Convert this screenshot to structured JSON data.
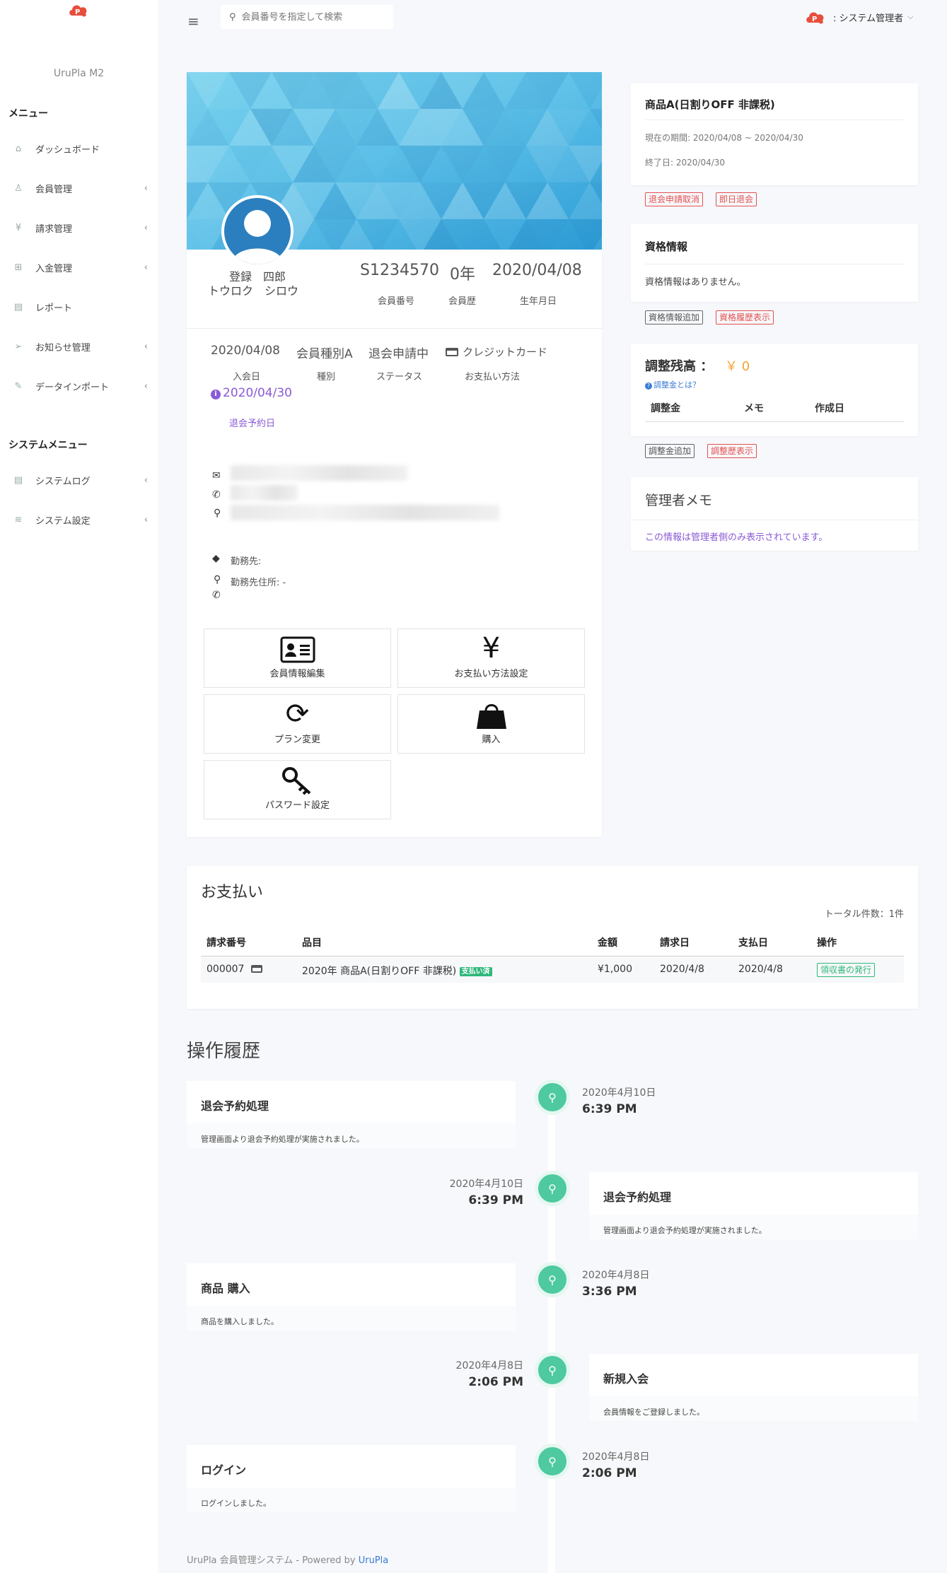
{
  "brand": "UruPla M2",
  "sidebar": {
    "menu_heading": "メニュー",
    "items": [
      {
        "label": "ダッシュボード",
        "icon": "home-icon"
      },
      {
        "label": "会員管理",
        "icon": "user-icon"
      },
      {
        "label": "請求管理",
        "icon": "yen-icon"
      },
      {
        "label": "入金管理",
        "icon": "bank-icon"
      },
      {
        "label": "レポート",
        "icon": "file-icon"
      },
      {
        "label": "お知らせ管理",
        "icon": "paper-plane-icon"
      },
      {
        "label": "データインポート",
        "icon": "edit-icon"
      }
    ],
    "system_heading": "システムメニュー",
    "system_items": [
      {
        "label": "システムログ",
        "icon": "file-icon"
      },
      {
        "label": "システム設定",
        "icon": "layers-icon"
      }
    ],
    "chevron": "‹"
  },
  "header": {
    "search_placeholder": "会員番号を指定して検索",
    "user_name": ": システム管理者"
  },
  "profile": {
    "name": "登録　四郎",
    "kana": "トウロク　シロウ",
    "member_no": "S1234570",
    "member_no_label": "会員番号",
    "years": "0年",
    "years_label": "会員歴",
    "birthday": "2020/04/08",
    "birthday_label": "生年月日",
    "join_date": "2020/04/08",
    "join_label": "入会日",
    "type": "会員種別A",
    "type_label": "種別",
    "status": "退会申請中",
    "status_label": "ステータス",
    "payment": "クレジットカード",
    "payment_label": "お支払い方法",
    "reserve_date": "2020/04/30",
    "reserve_label": "退会予約日",
    "workplace": "勤務先:",
    "workplace_address": "勤務先住所: -"
  },
  "actions": [
    {
      "label": "会員情報編集",
      "icon": "id-card-icon"
    },
    {
      "label": "お支払い方法設定",
      "icon": "yen-icon"
    },
    {
      "label": "プラン変更",
      "icon": "sync-icon"
    },
    {
      "label": "購入",
      "icon": "shopping-bag-icon"
    },
    {
      "label": "パスワード設定",
      "icon": "key-icon"
    }
  ],
  "product": {
    "title": "商品A(日割りOFF 非課税)",
    "period": "現在の期間: 2020/04/08 ~ 2020/04/30",
    "end": "終了日: 2020/04/30",
    "btn_cancel": "退会申請取消",
    "btn_immediate": "即日退会"
  },
  "qualification": {
    "title": "資格情報",
    "empty": "資格情報はありません。",
    "btn_add": "資格情報追加",
    "btn_history": "資格履歴表示"
  },
  "adjust": {
    "title": "調整残高 ：",
    "amount": "￥ 0",
    "help": "調整金とは？",
    "cols": [
      "調整金",
      "メモ",
      "作成日"
    ],
    "btn_add": "調整金追加",
    "btn_history": "調整歴表示"
  },
  "memo": {
    "title": "管理者メモ",
    "note": "この情報は管理者側のみ表示されています。"
  },
  "payments": {
    "title": "お支払い",
    "total": "トータル件数：1件",
    "headers": [
      "請求番号",
      "品目",
      "金額",
      "請求日",
      "支払日",
      "操作"
    ],
    "row": {
      "no": "000007",
      "item": "2020年 商品A(日割りOFF 非課税)",
      "badge": "支払い済",
      "amount": "¥1,000",
      "billed": "2020/4/8",
      "paid": "2020/4/8",
      "action": "領収書の発行"
    }
  },
  "history": {
    "title": "操作履歴",
    "events": [
      {
        "title": "退会予約処理",
        "desc": "管理画面より退会予約処理が実施されました。",
        "date": "2020年4月10日",
        "time": "6:39",
        "ampm": "PM"
      },
      {
        "title": "退会予約処理",
        "desc": "管理画面より退会予約処理が実施されました。",
        "date": "2020年4月10日",
        "time": "6:39",
        "ampm": "PM"
      },
      {
        "title": "商品 購入",
        "desc": "商品を購入しました。",
        "date": "2020年4月8日",
        "time": "3:36",
        "ampm": "PM"
      },
      {
        "title": "新規入会",
        "desc": "会員情報をご登録しました。",
        "date": "2020年4月8日",
        "time": "2:06",
        "ampm": "PM"
      },
      {
        "title": "ログイン",
        "desc": "ログインしました。",
        "date": "2020年4月8日",
        "time": "2:06",
        "ampm": "PM"
      }
    ]
  },
  "footer": {
    "text": "UruPla 会員管理システム - Powered by ",
    "link": "UruPla"
  },
  "colors": {
    "accent": "#4ec9a0",
    "danger": "#e45050",
    "purple": "#8a5ad6",
    "warning": "#f2a531"
  }
}
